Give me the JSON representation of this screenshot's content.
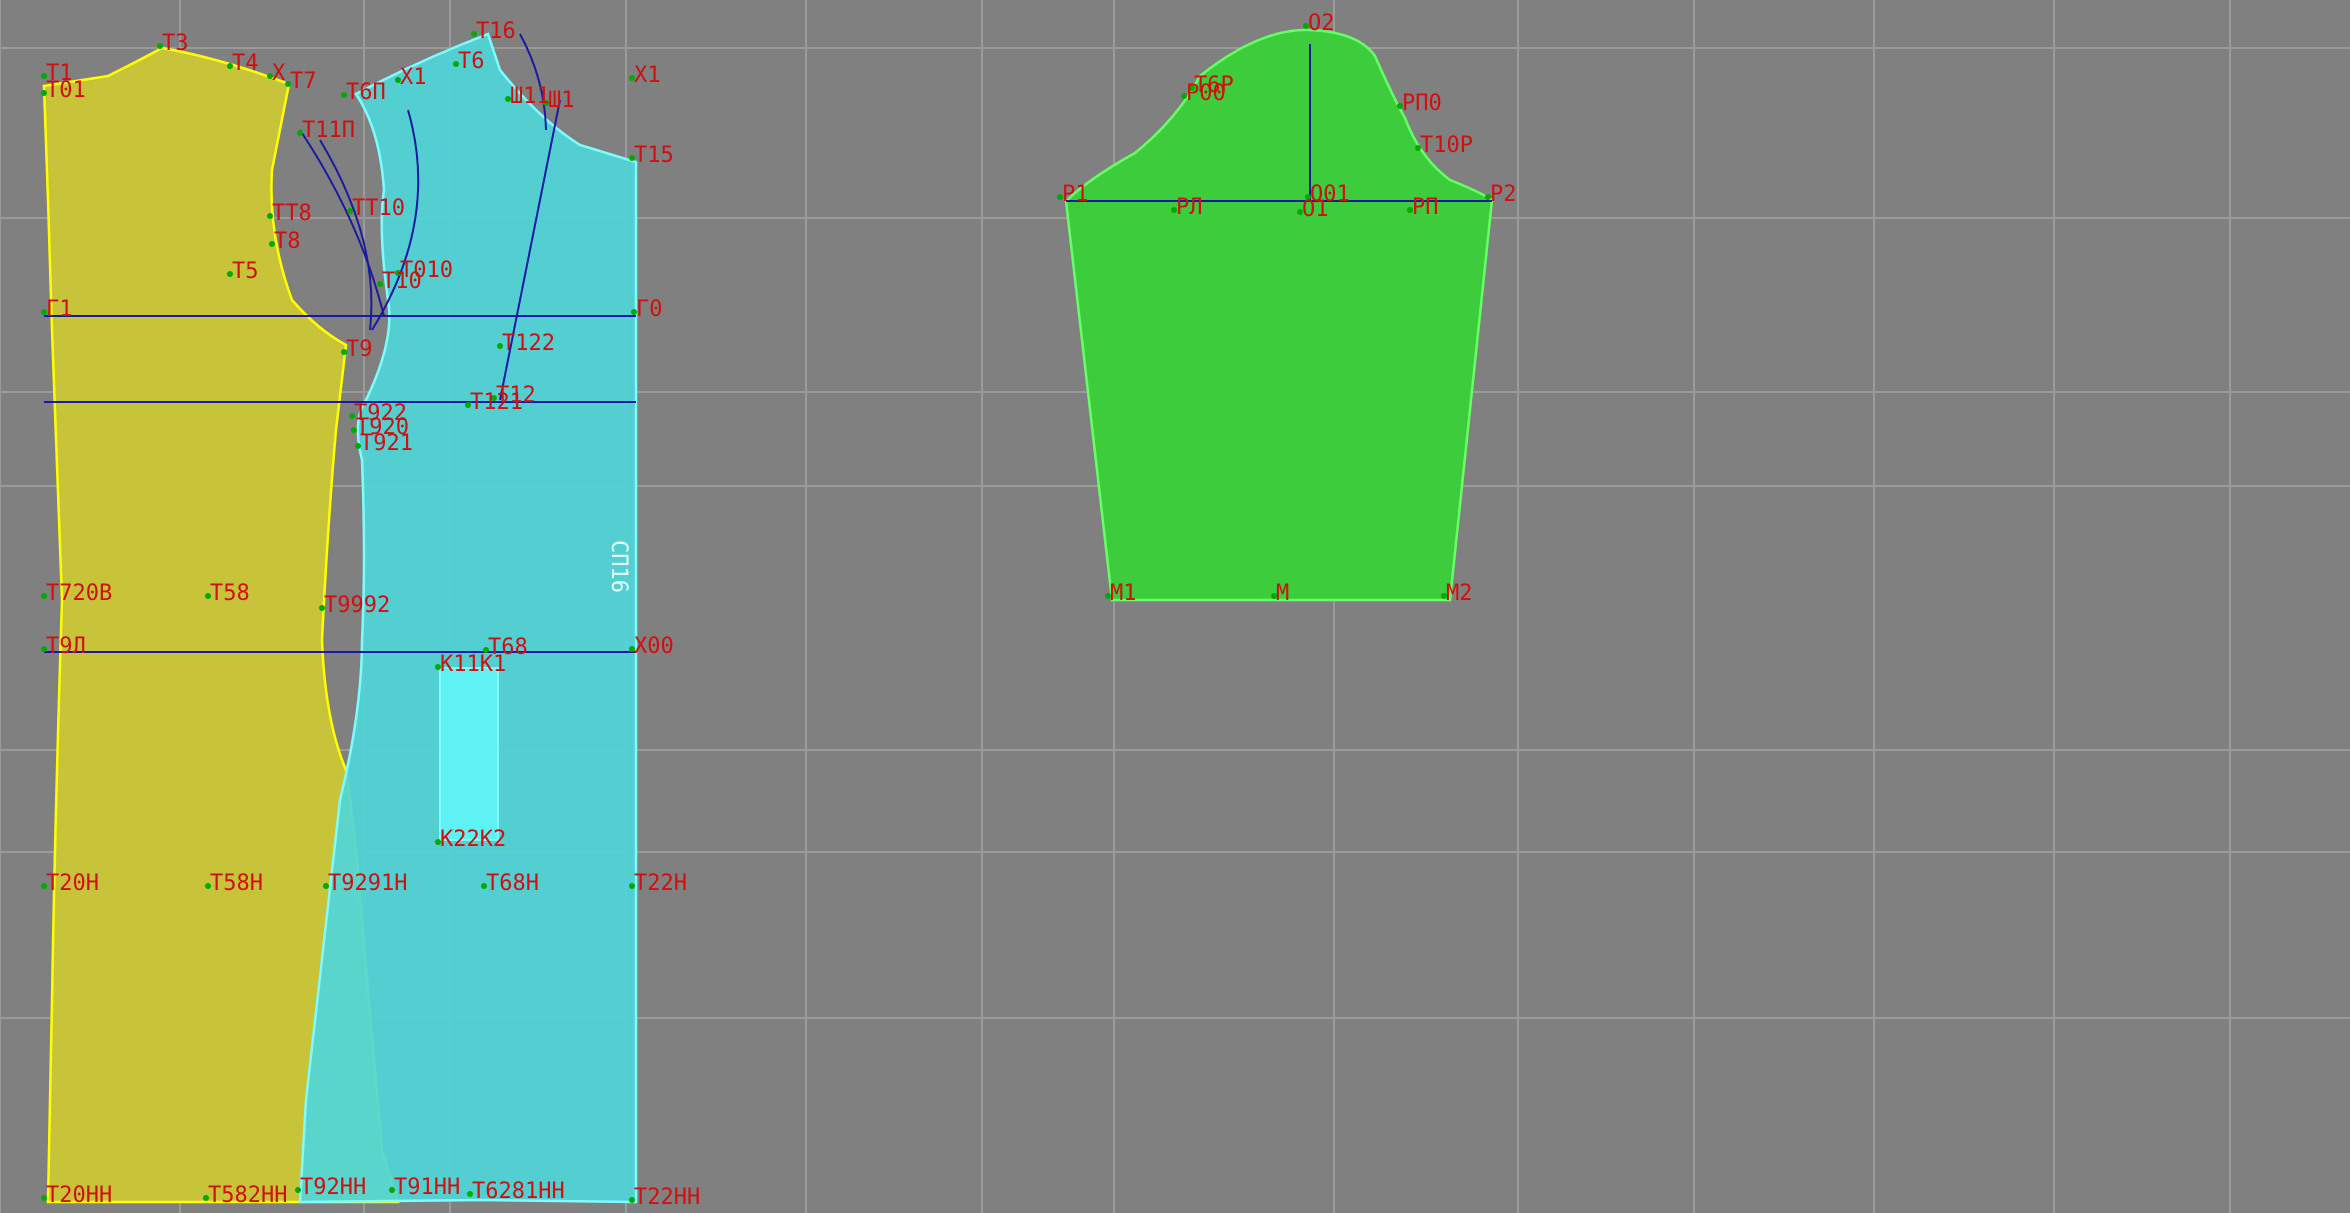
{
  "colors": {
    "background": "#808080",
    "grid": "#9a9a9a",
    "back_fill": "#c8c43a",
    "back_outline": "#ffff00",
    "front_fill": "#4fd6d8",
    "front_outline": "#7ffcff",
    "sleeve_fill": "#3ccc3c",
    "sleeve_outline": "#66ff66",
    "construction": "#1a1aa0",
    "label": "#d01010",
    "point": "#00aa00"
  },
  "vertical_text": "СП16",
  "labels": [
    {
      "id": "Т1",
      "text": "Т1"
    },
    {
      "id": "Т01",
      "text": "Т01"
    },
    {
      "id": "Т3",
      "text": "Т3"
    },
    {
      "id": "Т4",
      "text": "Т4"
    },
    {
      "id": "Х1a",
      "text": "Х"
    },
    {
      "id": "Т7",
      "text": "Т7"
    },
    {
      "id": "Т6П",
      "text": "Т6П"
    },
    {
      "id": "Х1b",
      "text": "Х1"
    },
    {
      "id": "Т16",
      "text": "Т16"
    },
    {
      "id": "Т6",
      "text": "Т6"
    },
    {
      "id": "Ш11",
      "text": "Ш11"
    },
    {
      "id": "Ш1",
      "text": "Ш1"
    },
    {
      "id": "Х1c",
      "text": "Х1"
    },
    {
      "id": "Т15",
      "text": "Т15"
    },
    {
      "id": "Т11П",
      "text": "Т11П"
    },
    {
      "id": "ТТ8",
      "text": "ТТ8"
    },
    {
      "id": "Т8",
      "text": "Т8"
    },
    {
      "id": "ТТ10",
      "text": "ТТ10"
    },
    {
      "id": "Т5",
      "text": "Т5"
    },
    {
      "id": "Т010",
      "text": "Т010"
    },
    {
      "id": "Т10",
      "text": "Т10"
    },
    {
      "id": "Г1",
      "text": "Г1"
    },
    {
      "id": "Г0",
      "text": "Г0"
    },
    {
      "id": "Т122",
      "text": "Т122"
    },
    {
      "id": "Т9",
      "text": "Т9"
    },
    {
      "id": "Т12",
      "text": "Т12"
    },
    {
      "id": "Т121",
      "text": "Т121"
    },
    {
      "id": "Т922",
      "text": "Т922"
    },
    {
      "id": "Т920",
      "text": "Т920"
    },
    {
      "id": "Т921",
      "text": "Т921"
    },
    {
      "id": "Т720В",
      "text": "Т720В"
    },
    {
      "id": "Т58",
      "text": "Т58"
    },
    {
      "id": "Т9992",
      "text": "Т9992"
    },
    {
      "id": "Т9Л",
      "text": "Т9Л"
    },
    {
      "id": "Т68",
      "text": "Т68"
    },
    {
      "id": "Х00",
      "text": "Х00"
    },
    {
      "id": "К11К1",
      "text": "К11К1"
    },
    {
      "id": "К22К2",
      "text": "К22К2"
    },
    {
      "id": "Т20Н",
      "text": "Т20Н"
    },
    {
      "id": "Т58Н",
      "text": "Т58Н"
    },
    {
      "id": "Т9291Н",
      "text": "Т9291Н"
    },
    {
      "id": "Т68Н",
      "text": "Т68Н"
    },
    {
      "id": "Т22Н",
      "text": "Т22Н"
    },
    {
      "id": "Т20НН",
      "text": "Т20НН"
    },
    {
      "id": "Т58НН",
      "text": "Т582НН"
    },
    {
      "id": "Т92НН",
      "text": "Т92НН"
    },
    {
      "id": "Т91НН",
      "text": "Т91НН"
    },
    {
      "id": "Т681НН",
      "text": "Т6281НН"
    },
    {
      "id": "Т22НН",
      "text": "Т22НН"
    },
    {
      "id": "О2",
      "text": "О2"
    },
    {
      "id": "Т6Р",
      "text": "Т6Р"
    },
    {
      "id": "Р00",
      "text": "Р00"
    },
    {
      "id": "РП0",
      "text": "РП0"
    },
    {
      "id": "Т10Р",
      "text": "Т10Р"
    },
    {
      "id": "Р1",
      "text": "Р1"
    },
    {
      "id": "РЛ",
      "text": "РЛ"
    },
    {
      "id": "О01",
      "text": "О01"
    },
    {
      "id": "О1",
      "text": "О1"
    },
    {
      "id": "РП",
      "text": "РП"
    },
    {
      "id": "Р2",
      "text": "Р2"
    },
    {
      "id": "М1",
      "text": "М1"
    },
    {
      "id": "М",
      "text": "М"
    },
    {
      "id": "М2",
      "text": "М2"
    }
  ]
}
